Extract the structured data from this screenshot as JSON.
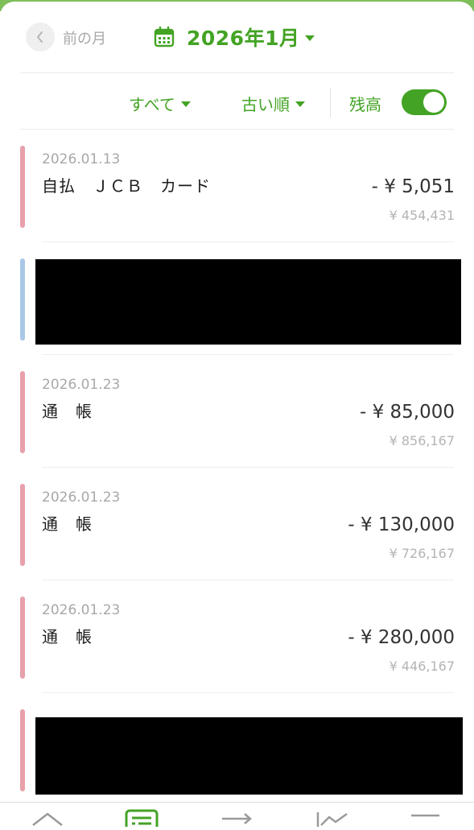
{
  "header": {
    "back_label": "前の月",
    "month_label": "2026年1月"
  },
  "filters": {
    "category": "すべて",
    "sort": "古い順",
    "balance_label": "残高",
    "balance_toggle_on": true
  },
  "colors": {
    "accent": "#43a324",
    "expense_marker": "#e8a0aa",
    "income_marker": "#a9c8e8",
    "redaction": "#000000"
  },
  "transactions": [
    {
      "date": "2026.01.13",
      "name": "自払　ＪＣＢ　カード",
      "amount": "- ¥ 5,051",
      "running_balance": "¥ 454,431",
      "marker": "expense"
    },
    {
      "marker": "income",
      "redacted": true
    },
    {
      "date": "2026.01.23",
      "name": "通　帳",
      "amount": "- ¥ 85,000",
      "running_balance": "¥ 856,167",
      "marker": "expense"
    },
    {
      "date": "2026.01.23",
      "name": "通　帳",
      "amount": "- ¥ 130,000",
      "running_balance": "¥ 726,167",
      "marker": "expense"
    },
    {
      "date": "2026.01.23",
      "name": "通　帳",
      "amount": "- ¥ 280,000",
      "running_balance": "¥ 446,167",
      "marker": "expense"
    },
    {
      "marker": "expense",
      "redacted": true
    }
  ],
  "tabbar": {
    "tabs": [
      "home-icon",
      "list-icon",
      "transfer-icon",
      "chart-icon",
      "menu-icon"
    ],
    "active_index": 1
  }
}
